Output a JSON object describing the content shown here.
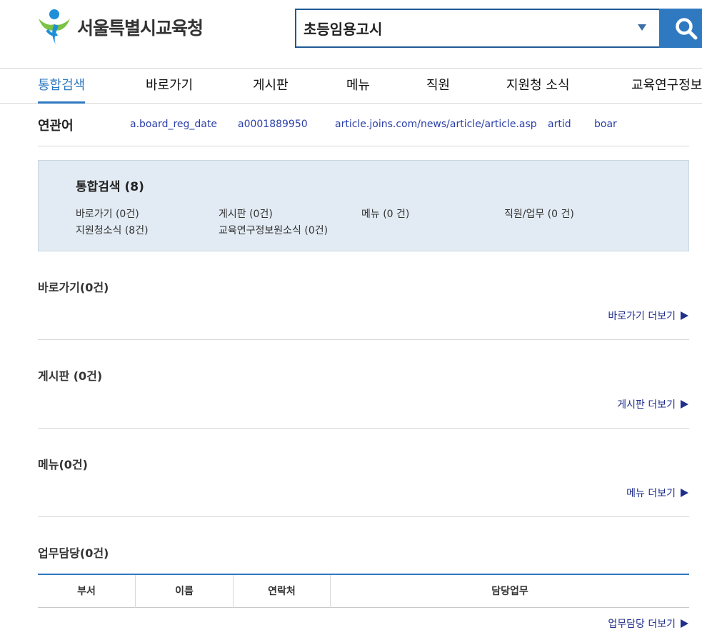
{
  "header": {
    "logo_text": "서울특별시교육청",
    "search_value": "초등임용고시"
  },
  "nav": {
    "tabs": [
      "통합검색",
      "바로가기",
      "게시판",
      "메뉴",
      "직원",
      "지원청 소식",
      "교육연구정보"
    ],
    "active_index": 0
  },
  "related": {
    "label": "연관어",
    "keywords": [
      "a.board_reg_date",
      "a0001889950",
      "article.joins.com/news/article/article.asp",
      "artid",
      "boar"
    ]
  },
  "summary": {
    "title": "통합검색 (8)",
    "links": [
      "바로가기 (0건)",
      "게시판 (0건)",
      "메뉴 (0 건)",
      "직원/업무 (0 건)",
      "지원청소식 (8건)",
      "교육연구정보원소식 (0건)"
    ]
  },
  "sections": {
    "shortcut": {
      "title": "바로가기(0건)",
      "more": "바로가기 더보기"
    },
    "board": {
      "title": "게시판 (0건)",
      "more": "게시판 더보기"
    },
    "menu": {
      "title": "메뉴(0건)",
      "more": "메뉴 더보기"
    },
    "duty": {
      "title": "업무담당(0건)",
      "more": "업무담당 더보기",
      "columns": [
        "부서",
        "이름",
        "연락처",
        "담당업무"
      ]
    }
  },
  "colors": {
    "accent": "#2f79c0",
    "link": "#2a3fa8",
    "summary_bg": "#e2ebf3"
  }
}
